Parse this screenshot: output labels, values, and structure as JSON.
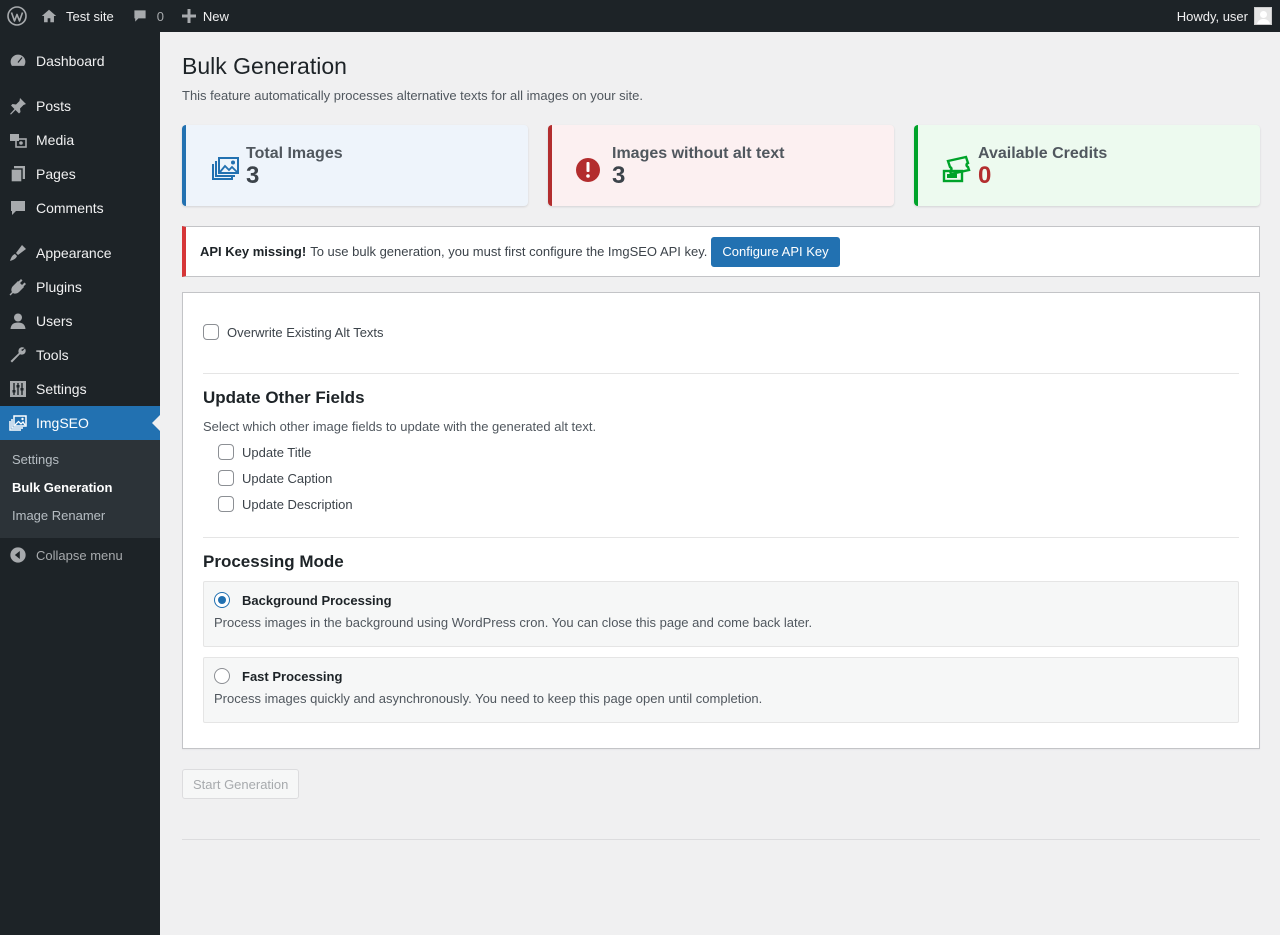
{
  "adminbar": {
    "site_name": "Test site",
    "comments_count": "0",
    "new_label": "New",
    "greeting": "Howdy, user"
  },
  "menu": {
    "items": [
      {
        "label": "Dashboard",
        "icon": "dashboard-icon"
      },
      {
        "label": "Posts",
        "icon": "pin-icon"
      },
      {
        "label": "Media",
        "icon": "media-icon"
      },
      {
        "label": "Pages",
        "icon": "pages-icon"
      },
      {
        "label": "Comments",
        "icon": "comment-icon"
      },
      {
        "label": "Appearance",
        "icon": "brush-icon"
      },
      {
        "label": "Plugins",
        "icon": "plug-icon"
      },
      {
        "label": "Users",
        "icon": "user-icon"
      },
      {
        "label": "Tools",
        "icon": "wrench-icon"
      },
      {
        "label": "Settings",
        "icon": "sliders-icon"
      },
      {
        "label": "ImgSEO",
        "icon": "images-icon"
      }
    ],
    "submenu": [
      "Settings",
      "Bulk Generation",
      "Image Renamer"
    ],
    "collapse_label": "Collapse menu"
  },
  "page": {
    "title": "Bulk Generation",
    "description": "This feature automatically processes alternative texts for all images on your site."
  },
  "stats": {
    "total_label": "Total Images",
    "total_value": "3",
    "missing_label": "Images without alt text",
    "missing_value": "3",
    "credits_label": "Available Credits",
    "credits_value": "0"
  },
  "notice": {
    "bold": "API Key missing!",
    "text": "To use bulk generation, you must first configure the ImgSEO API key.",
    "button": "Configure API Key"
  },
  "options": {
    "overwrite_label": "Overwrite Existing Alt Texts",
    "other_fields_title": "Update Other Fields",
    "other_fields_help": "Select which other image fields to update with the generated alt text.",
    "update_title": "Update Title",
    "update_caption": "Update Caption",
    "update_description": "Update Description",
    "mode_title": "Processing Mode",
    "background_title": "Background Processing",
    "background_desc": "Process images in the background using WordPress cron. You can close this page and come back later.",
    "fast_title": "Fast Processing",
    "fast_desc": "Process images quickly and asynchronously. You need to keep this page open until completion.",
    "selected_mode": "Background Processing"
  },
  "start_button": "Start Generation",
  "colors": {
    "accent": "#2271b1",
    "error": "#b32d2e",
    "success": "#00a32a",
    "sidebar": "#1d2327"
  }
}
